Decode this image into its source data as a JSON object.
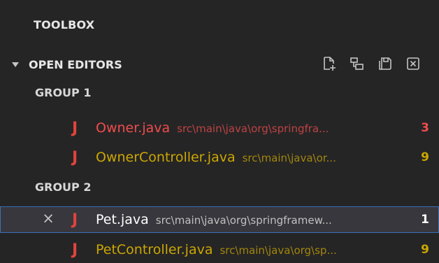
{
  "panel": {
    "title": "TOOLBOX"
  },
  "section": {
    "title": "OPEN EDITORS",
    "actions": [
      "new-untitled-file-icon",
      "toggle-vertical-layout-icon",
      "save-all-icon",
      "close-all-icon"
    ]
  },
  "groups": [
    {
      "label": "GROUP 1",
      "files": [
        {
          "icon": "J",
          "name": "Owner.java",
          "path": "src\\main\\java\\org\\springfra...",
          "badge": "3",
          "status": "error"
        },
        {
          "icon": "J",
          "name": "OwnerController.java",
          "path": "src\\main\\java\\or...",
          "badge": "9",
          "status": "warning"
        }
      ]
    },
    {
      "label": "GROUP 2",
      "files": [
        {
          "icon": "J",
          "name": "Pet.java",
          "path": "src\\main\\java\\org\\springframew...",
          "badge": "1",
          "status": "selected",
          "close": "×"
        },
        {
          "icon": "J",
          "name": "PetController.java",
          "path": "src\\main\\java\\org\\sp...",
          "badge": "9",
          "status": "warning"
        }
      ]
    }
  ],
  "colors": {
    "error": "#f14c4c",
    "warning": "#cca700",
    "java_icon": "#e0443a",
    "selection_border": "#3b6fb6"
  }
}
